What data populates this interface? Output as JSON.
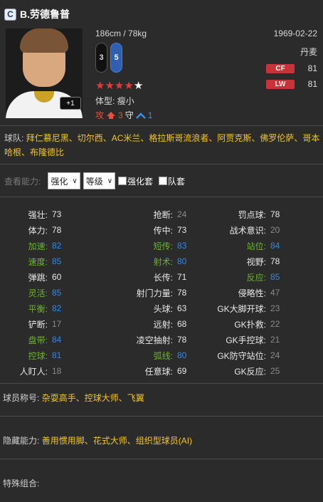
{
  "player": {
    "position_badge": "C",
    "name": "B.劳德鲁普",
    "height_weight": "186cm / 78kg",
    "birthdate": "1969-02-22",
    "nationality": "丹麦",
    "rank_badge": "+1",
    "weak_foot_left": "3",
    "weak_foot_right": "5",
    "stars_filled": 4,
    "stars_total": 5,
    "body_type_label": "体型:",
    "body_type_value": "瘦小",
    "attack_label": "攻",
    "attack_value": "3",
    "defense_label": "守",
    "defense_value": "1"
  },
  "positions": [
    {
      "tag": "CF",
      "value": "81"
    },
    {
      "tag": "LW",
      "value": "81"
    }
  ],
  "clubs": {
    "label": "球队:",
    "value": "拜仁慕尼黑、切尔西、AC米兰、格拉斯哥流浪者、阿贾克斯、佛罗伦萨、哥本哈根、布隆德比"
  },
  "filter": {
    "label": "查看能力:",
    "select1": "强化",
    "select2": "等级",
    "check1": "强化套",
    "check2": "队套"
  },
  "stats": {
    "col1": [
      {
        "label": "强壮:",
        "value": "73",
        "color": "white"
      },
      {
        "label": "体力:",
        "value": "78",
        "color": "white"
      },
      {
        "label": "加速:",
        "value": "82",
        "color": "green"
      },
      {
        "label": "速度:",
        "value": "85",
        "color": "green"
      },
      {
        "label": "弹跳:",
        "value": "60",
        "color": "white"
      },
      {
        "label": "灵活:",
        "value": "85",
        "color": "green"
      },
      {
        "label": "平衡:",
        "value": "82",
        "color": "green"
      },
      {
        "label": "铲断:",
        "value": "17",
        "color": "gray"
      },
      {
        "label": "盘带:",
        "value": "84",
        "color": "green"
      },
      {
        "label": "控球:",
        "value": "81",
        "color": "green"
      },
      {
        "label": "人盯人:",
        "value": "18",
        "color": "gray"
      }
    ],
    "col2": [
      {
        "label": "抢断:",
        "value": "24",
        "color": "gray"
      },
      {
        "label": "传中:",
        "value": "73",
        "color": "white"
      },
      {
        "label": "短传:",
        "value": "83",
        "color": "green"
      },
      {
        "label": "射术:",
        "value": "80",
        "color": "green"
      },
      {
        "label": "长传:",
        "value": "71",
        "color": "white"
      },
      {
        "label": "射门力量:",
        "value": "78",
        "color": "white"
      },
      {
        "label": "头球:",
        "value": "63",
        "color": "white"
      },
      {
        "label": "远射:",
        "value": "68",
        "color": "white"
      },
      {
        "label": "凌空抽射:",
        "value": "78",
        "color": "white"
      },
      {
        "label": "弧线:",
        "value": "80",
        "color": "green"
      },
      {
        "label": "任意球:",
        "value": "69",
        "color": "white"
      }
    ],
    "col3": [
      {
        "label": "罚点球:",
        "value": "78",
        "color": "white"
      },
      {
        "label": "战术意识:",
        "value": "20",
        "color": "gray"
      },
      {
        "label": "站位:",
        "value": "84",
        "color": "green"
      },
      {
        "label": "视野:",
        "value": "78",
        "color": "white"
      },
      {
        "label": "反应:",
        "value": "85",
        "color": "green"
      },
      {
        "label": "侵略性:",
        "value": "47",
        "color": "gray"
      },
      {
        "label": "GK大脚开球:",
        "value": "23",
        "color": "gray"
      },
      {
        "label": "GK扑救:",
        "value": "22",
        "color": "gray"
      },
      {
        "label": "GK手控球:",
        "value": "21",
        "color": "gray"
      },
      {
        "label": "GK防守站位:",
        "value": "24",
        "color": "gray"
      },
      {
        "label": "GK反应:",
        "value": "25",
        "color": "gray"
      }
    ]
  },
  "traits": {
    "label": "球员称号:",
    "value": "杂耍高手、控球大师、飞翼"
  },
  "hidden": {
    "label": "隐藏能力:",
    "value": "善用惯用脚、花式大师、组织型球员(AI)"
  },
  "special": {
    "label": "特殊组合:"
  },
  "colors": {
    "background": "#2b2b2b",
    "highlight_yellow": "#f3c624",
    "stat_green": "#6bb42c",
    "stat_blue": "#3b86d8",
    "position_red": "#c8333a"
  }
}
